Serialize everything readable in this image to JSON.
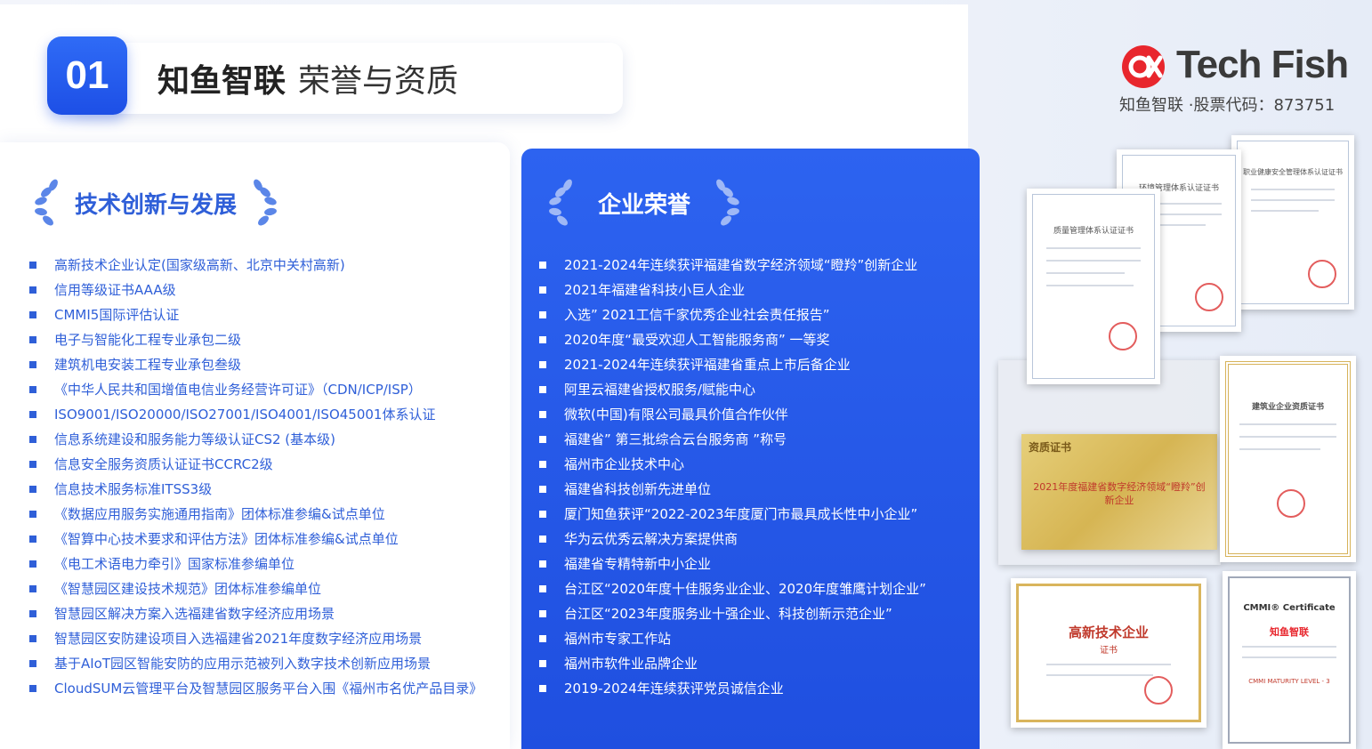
{
  "header": {
    "number": "01",
    "title_strong": "知鱼智联",
    "title_light": "荣誉与资质"
  },
  "logo": {
    "wordmark": "Tech Fish",
    "subtitle": "知鱼智联 ·股票代码：873751",
    "color": "#e8262d"
  },
  "left_section": {
    "title": "技术创新与发展",
    "items": [
      "高新技术企业认定(国家级高新、北京中关村高新)",
      "信用等级证书AAA级",
      " CMMI5国际评估认证",
      "电子与智能化工程专业承包二级",
      "建筑机电安装工程专业承包叁级",
      "《中华人民共和国增值电信业务经营许可证》（CDN/ICP/ISP）",
      "ISO9001/ISO20000/ISO27001/ISO4001/ISO45001体系认证",
      "信息系统建设和服务能力等级认证CS2 (基本级)",
      "信息安全服务资质认证证书CCRC2级",
      "信息技术服务标准ITSS3级",
      "《数据应用服务实施通用指南》团体标准参编&试点单位",
      "《智算中心技术要求和评估方法》团体标准参编&试点单位",
      "《电工术语电力牵引》国家标准参编单位",
      "《智慧园区建设技术规范》团体标准参编单位",
      "智慧园区解决方案入选福建省数字经济应用场景",
      "智慧园区安防建设项目入选福建省2021年度数字经济应用场景",
      "基于AIoT园区智能安防的应用示范被列入数字技术创新应用场景",
      "CloudSUM云管理平台及智慧园区服务平台入围《福州市名优产品目录》"
    ]
  },
  "right_section": {
    "title": "企业荣誉",
    "items": [
      "2021-2024年连续获评福建省数字经济领域“瞪羚”创新企业",
      "2021年福建省科技小巨人企业",
      "入选” 2021工信千家优秀企业社会责任报告”",
      "2020年度“最受欢迎人工智能服务商” 一等奖",
      "2021-2024年连续获评福建省重点上市后备企业",
      "阿里云福建省授权服务/赋能中心",
      "微软(中国)有限公司最具价值合作伙伴",
      "福建省” 第三批综合云台服务商 ”称号",
      "福州市企业技术中心",
      "福建省科技创新先进单位",
      "厦门知鱼获评“2022-2023年度厦门市最具成长性中小企业”",
      "华为云优秀云解决方案提供商",
      "福建省专精特新中小企业",
      "台江区“2020年度十佳服务业企业、2020年度雏鹰计划企业”",
      "台江区“2023年度服务业十强企业、科技创新示范企业”",
      "福州市专家工作站",
      "福州市软件业品牌企业",
      "2019-2024年连续获评党员诚信企业"
    ]
  },
  "certificates": {
    "quality": "质量管理体系认证证书",
    "environment": "环境管理体系认证证书",
    "safety": "职业健康安全管理体系认证证书",
    "construction": "建筑业企业资质证书",
    "gold_plaque": "2021年度福建省数字经济领域“瞪羚”创新企业",
    "gold_plaque_header": "资质证书",
    "hightech": "高新技术企业",
    "hightech_sub": "证书",
    "cmmi_title": "CMMI® Certificate",
    "cmmi_company": "知鱼智联",
    "cmmi_level": "CMMI MATURITY LEVEL - 3"
  }
}
